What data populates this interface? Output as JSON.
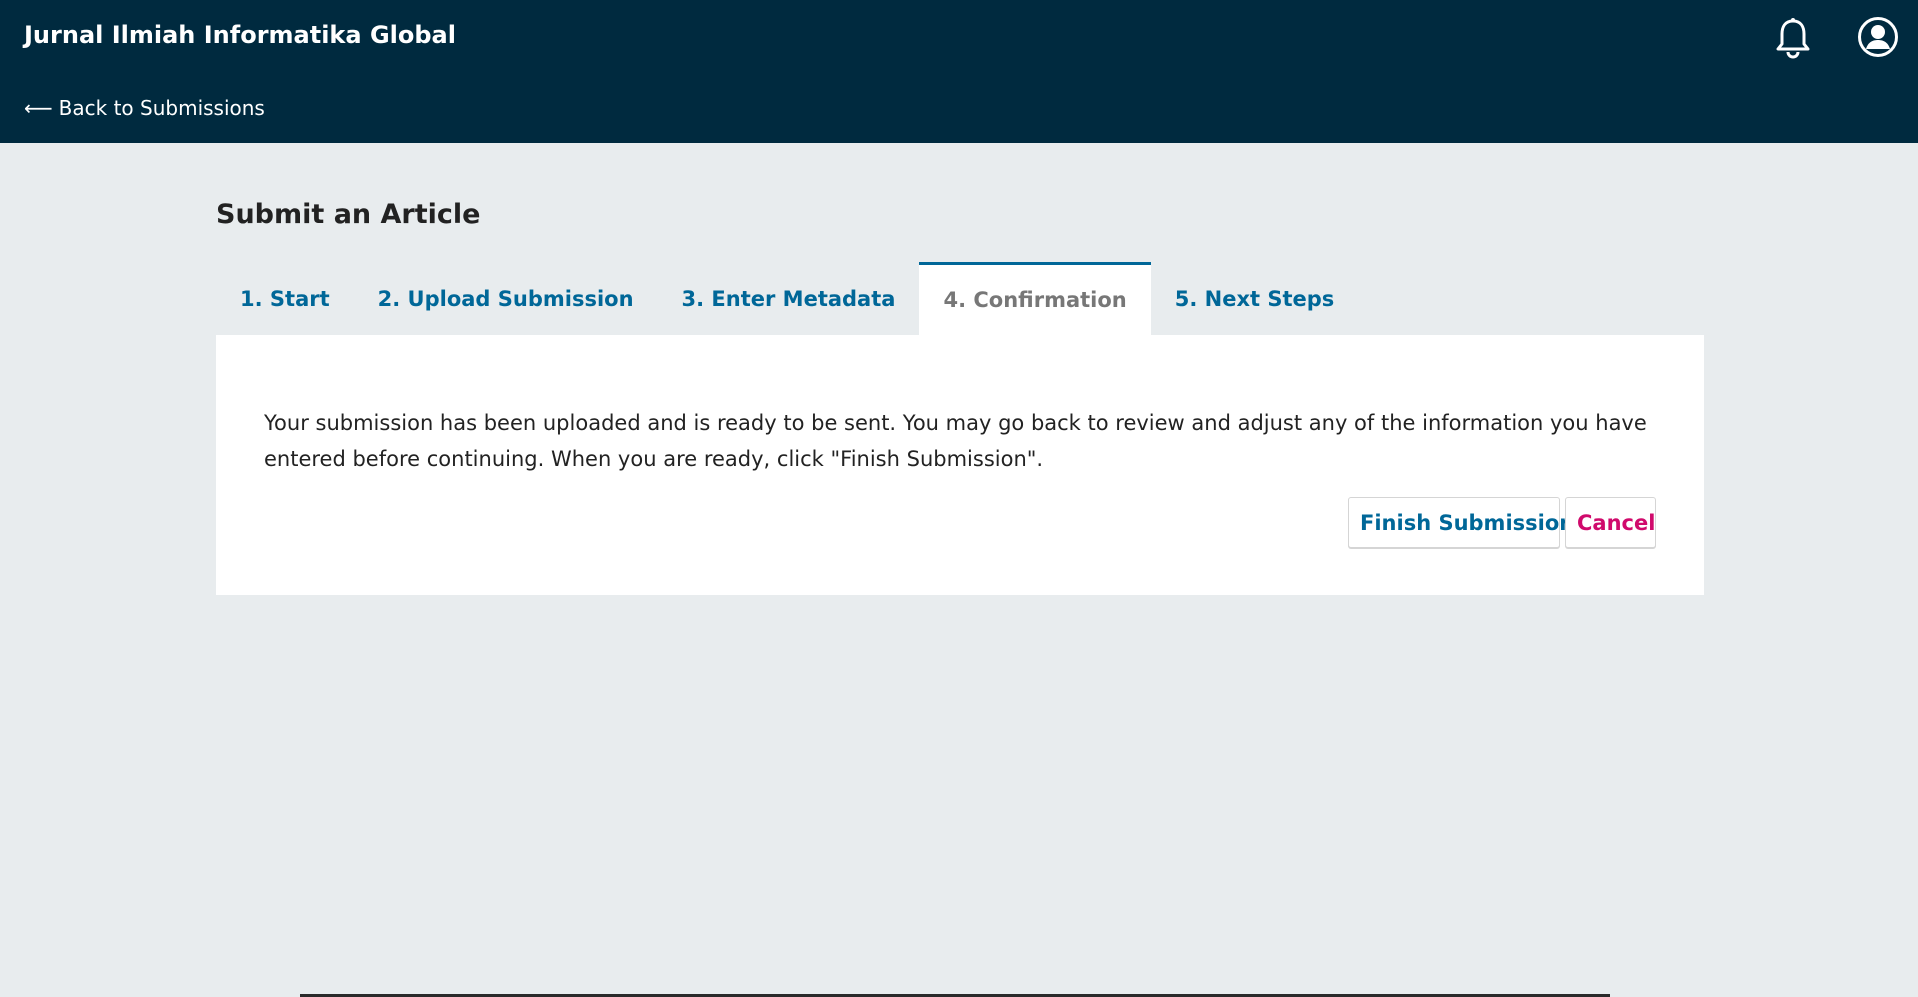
{
  "header": {
    "site_title": "Jurnal Ilmiah Informatika Global",
    "back_arrow": "⟵",
    "back_label": "Back to Submissions",
    "notifications_icon": "bell-icon",
    "user_icon": "user-circle-icon"
  },
  "page": {
    "title": "Submit an Article"
  },
  "tabs": [
    {
      "label": "1. Start",
      "active": false
    },
    {
      "label": "2. Upload Submission",
      "active": false
    },
    {
      "label": "3. Enter Metadata",
      "active": false
    },
    {
      "label": "4. Confirmation",
      "active": true
    },
    {
      "label": "5. Next Steps",
      "active": false
    }
  ],
  "confirmation": {
    "message": "Your submission has been uploaded and is ready to be sent. You may go back to review and adjust any of the information you have entered before continuing. When you are ready, click \"Finish Submission\".",
    "finish_label": "Finish Submission",
    "cancel_label": "Cancel"
  },
  "colors": {
    "header_bg": "#002a3f",
    "page_bg": "#e8ecee",
    "link_blue": "#006798",
    "cancel_pink": "#d00a6c",
    "inactive_text": "#777777"
  }
}
